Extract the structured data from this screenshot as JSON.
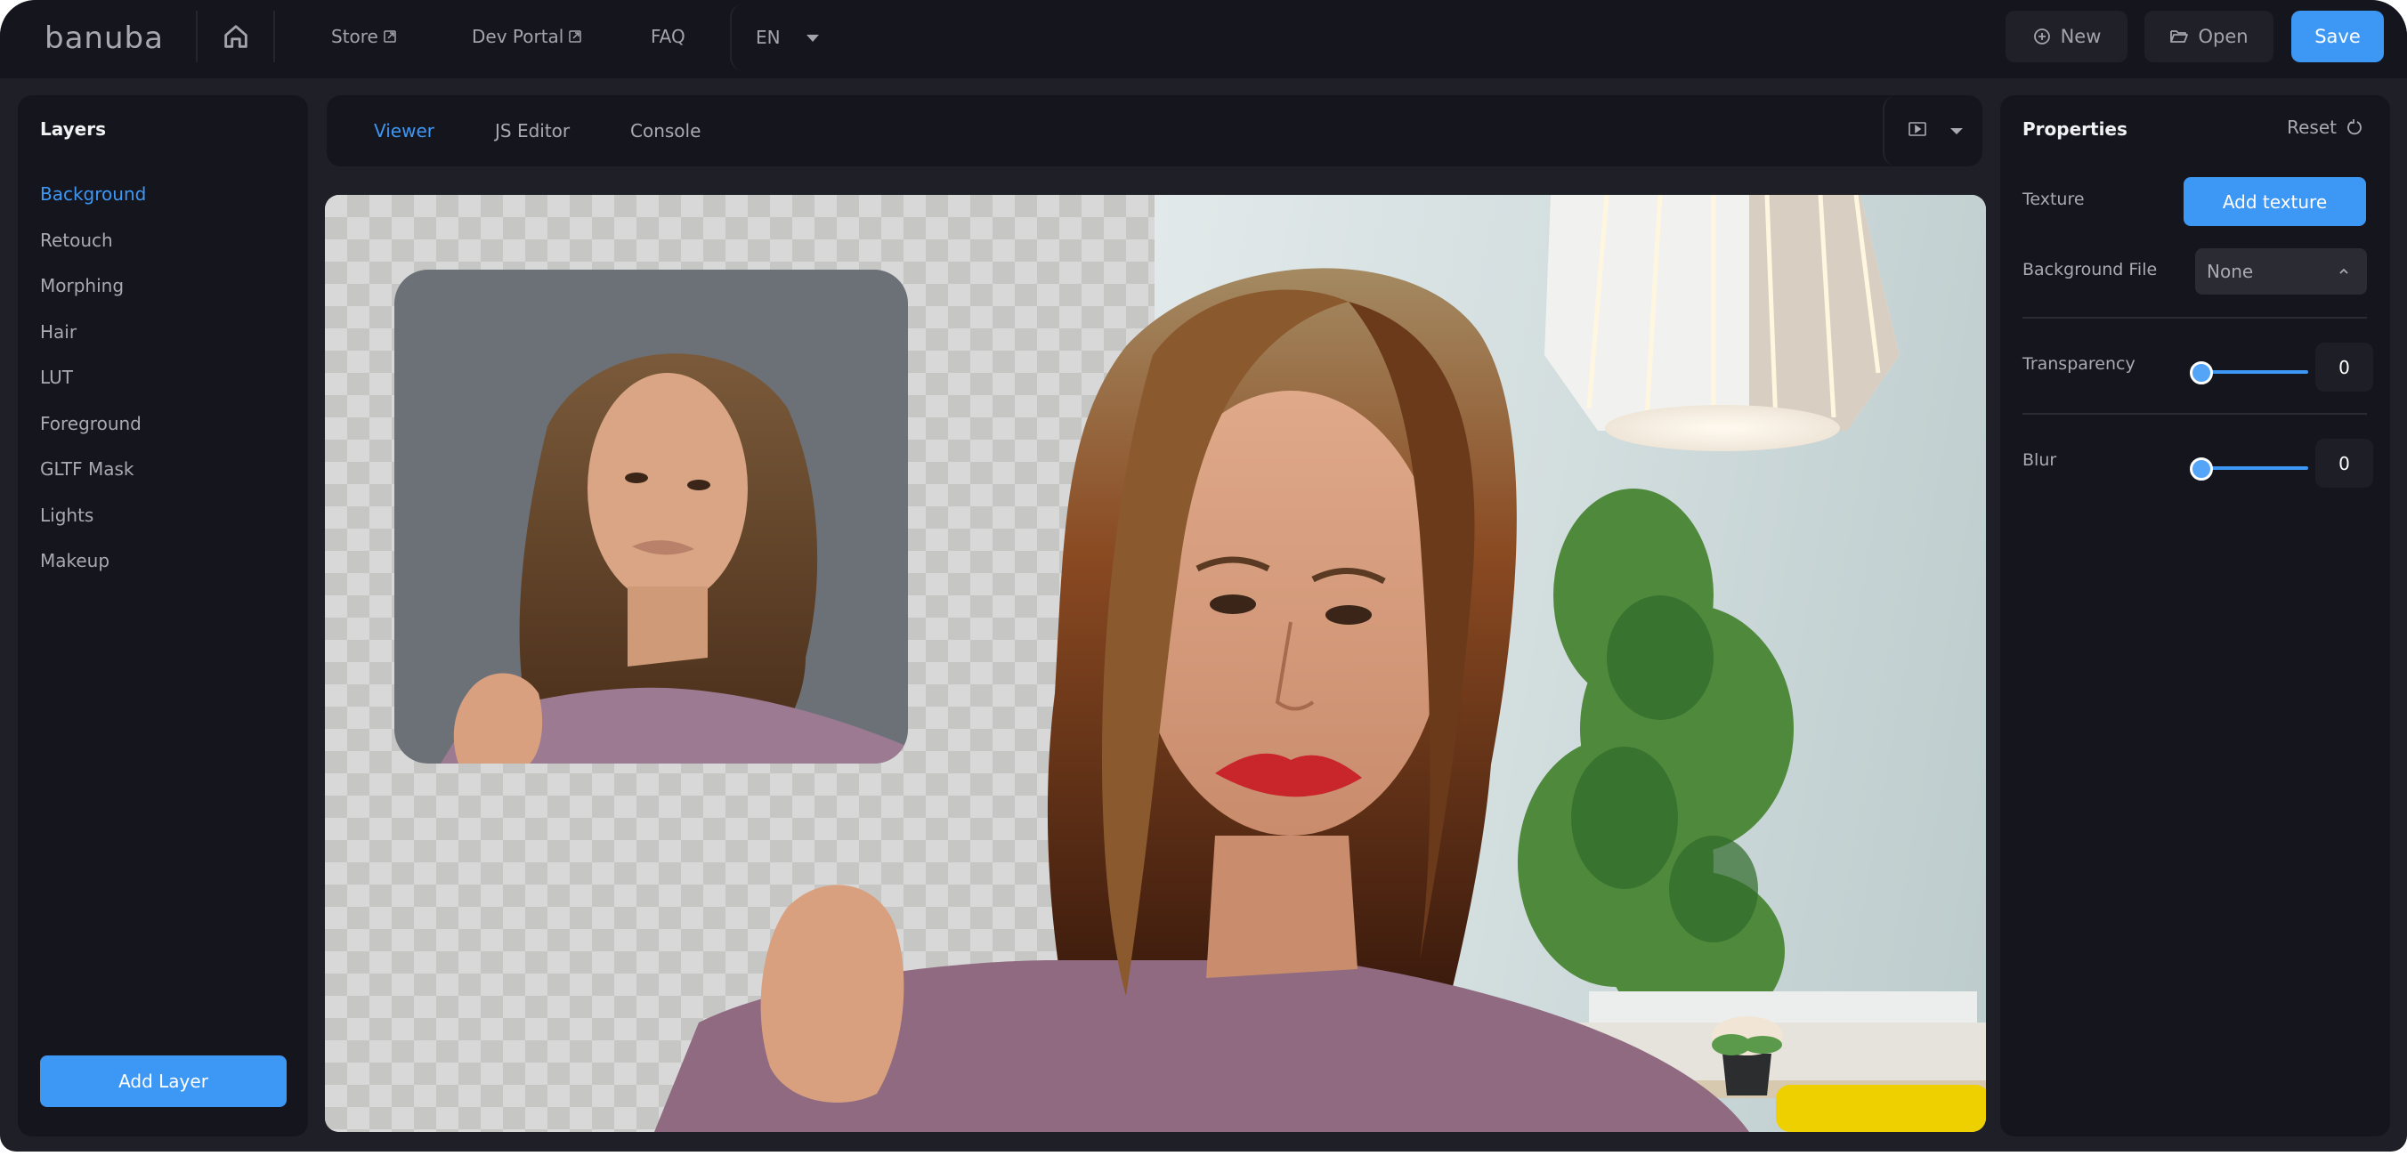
{
  "header": {
    "logo": "banuba",
    "home_icon": "home-icon",
    "nav": [
      {
        "label": "Store",
        "external": true
      },
      {
        "label": "Dev Portal",
        "external": true
      },
      {
        "label": "FAQ",
        "external": false
      }
    ],
    "language": "EN",
    "buttons": {
      "new": "New",
      "open": "Open",
      "save": "Save"
    }
  },
  "layers": {
    "title": "Layers",
    "items": [
      {
        "label": "Background",
        "active": true
      },
      {
        "label": "Retouch",
        "active": false
      },
      {
        "label": "Morphing",
        "active": false
      },
      {
        "label": "Hair",
        "active": false
      },
      {
        "label": "LUT",
        "active": false
      },
      {
        "label": "Foreground",
        "active": false
      },
      {
        "label": "GLTF Mask",
        "active": false
      },
      {
        "label": "Lights",
        "active": false
      },
      {
        "label": "Makeup",
        "active": false
      }
    ],
    "add_button": "Add Layer"
  },
  "viewer": {
    "tabs": [
      {
        "label": "Viewer",
        "active": true
      },
      {
        "label": "JS Editor",
        "active": false
      },
      {
        "label": "Console",
        "active": false
      }
    ],
    "preview_icon": "play-preview-icon"
  },
  "properties": {
    "title": "Properties",
    "reset_label": "Reset",
    "texture_label": "Texture",
    "add_texture_button": "Add texture",
    "background_file_label": "Background File",
    "background_file_value": "None",
    "transparency": {
      "label": "Transparency",
      "value": "0",
      "fraction": 0
    },
    "blur": {
      "label": "Blur",
      "value": "0",
      "fraction": 0
    }
  },
  "colors": {
    "accent": "#3d97f5",
    "panel_bg": "#15161d",
    "app_bg": "#1e1f27",
    "text_muted": "#a9aab1"
  }
}
